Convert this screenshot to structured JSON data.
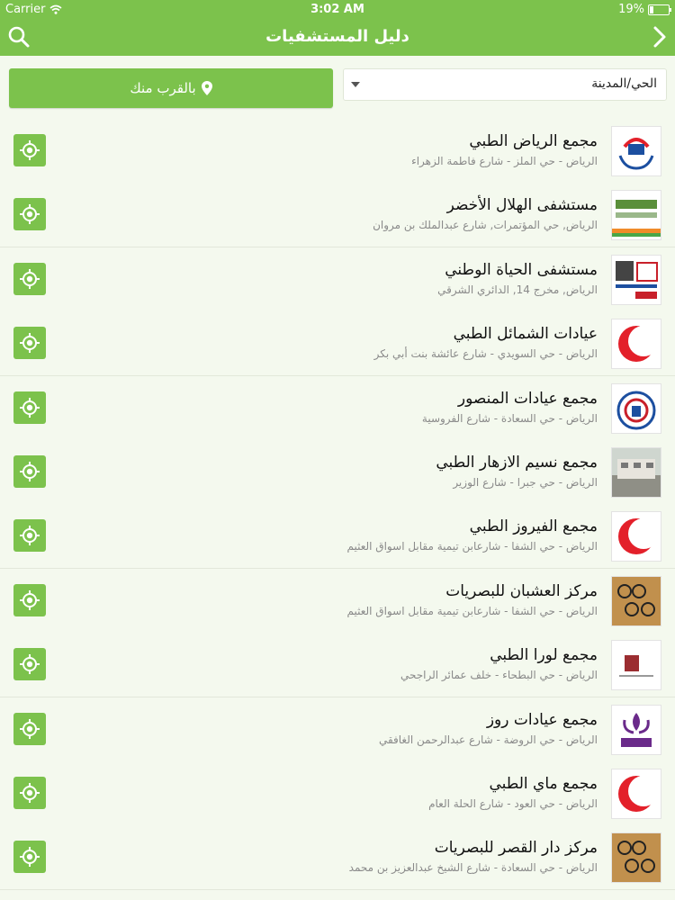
{
  "status": {
    "carrier": "Carrier",
    "time": "3:02 AM",
    "battery": "19%",
    "battery_level": 0.19
  },
  "nav": {
    "title": "دليل المستشفيات"
  },
  "filters": {
    "near_label": "بالقرب منك",
    "city_value": "الحي/المدينة"
  },
  "colors": {
    "brand_green": "#7cc24c",
    "background": "#f4f9ee",
    "name_text": "#111111",
    "address_text": "#8a8a8a"
  },
  "items": [
    {
      "name": "مجمع الرياض الطبي",
      "address": "الرياض - حي الملز - شارع فاطمة الزهراء",
      "logo": "rc-hands-logo"
    },
    {
      "name": "مستشفى الهلال الأخضر",
      "address": "الرياض, حي المؤتمرات, شارع عبدالملك بن مروان",
      "logo": "green-crescent-logo"
    },
    {
      "name": "مستشفى الحياة الوطني",
      "address": "الرياض, مخرج 14, الدائري الشرقي",
      "logo": "hnh-logo"
    },
    {
      "name": "عيادات الشمائل الطبي",
      "address": "الرياض - حي السويدي - شارع عائشة بنت أبي بكر",
      "logo": "red-crescent-logo"
    },
    {
      "name": "مجمع عيادات المنصور",
      "address": "الرياض - حي السعادة - شارع الفروسية",
      "logo": "mansour-logo"
    },
    {
      "name": "مجمع نسيم الازهار الطبي",
      "address": "الرياض - حي جبرا - شارع الوزير",
      "logo": "building-photo"
    },
    {
      "name": "مجمع الفيروز الطبي",
      "address": "الرياض - حي الشفا - شارعابن تيمية مقابل اسواق العثيم",
      "logo": "red-crescent-logo"
    },
    {
      "name": "مركز العشبان للبصريات",
      "address": "الرياض - حي الشفا - شارعابن تيمية مقابل اسواق العثيم",
      "logo": "glasses-photo"
    },
    {
      "name": "مجمع لورا الطبي",
      "address": "الرياض - حي البطحاء - خلف عمائر الراجحي",
      "logo": "lora-logo"
    },
    {
      "name": "مجمع عيادات روز",
      "address": "الرياض - حي الروضة - شارع عبدالرحمن الغافقي",
      "logo": "roze-logo"
    },
    {
      "name": "مجمع ماي الطبي",
      "address": "الرياض - حي العود - شارع الحلة العام",
      "logo": "red-crescent-logo"
    },
    {
      "name": "مركز دار القصر للبصريات",
      "address": "الرياض - حي السعادة - شارع الشيخ عبدالعزيز بن محمد",
      "logo": "glasses-photo"
    }
  ]
}
